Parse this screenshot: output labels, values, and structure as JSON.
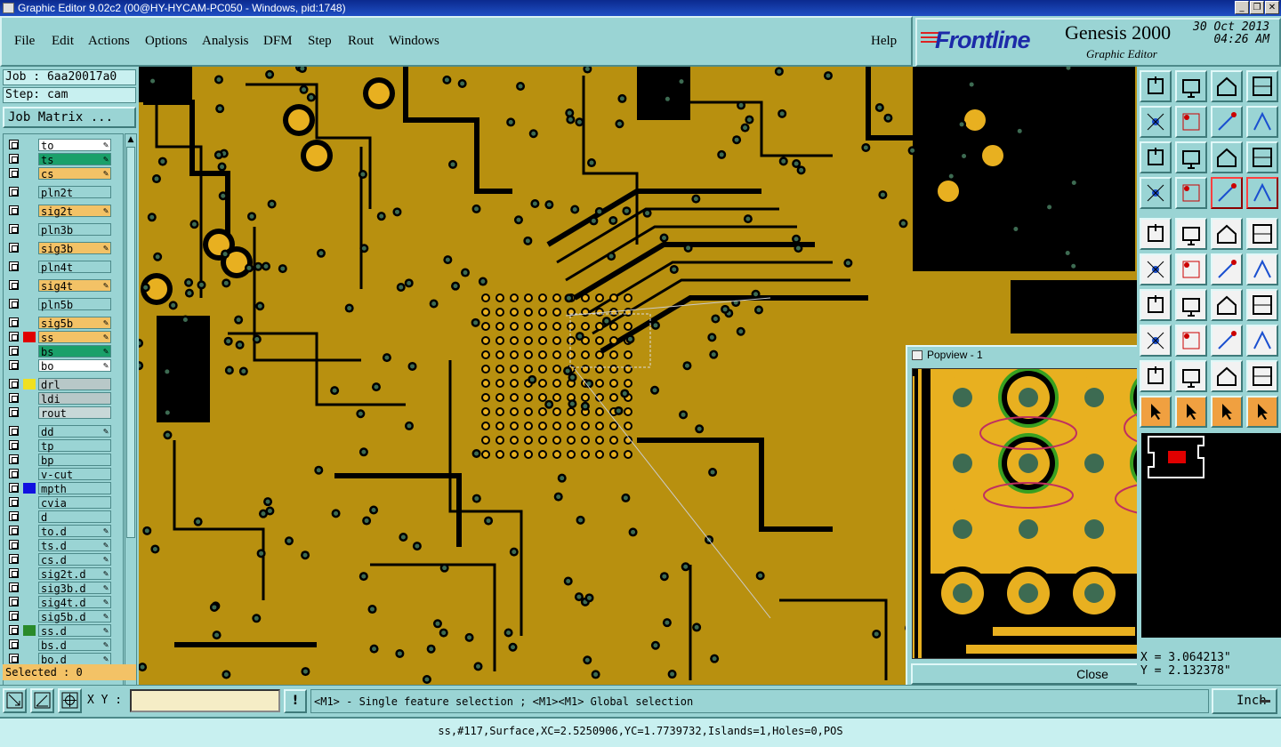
{
  "window": {
    "title": "Graphic Editor 9.02c2 (00@HY-HYCAM-PC050 - Windows, pid:1748)"
  },
  "menu": [
    "File",
    "Edit",
    "Actions",
    "Options",
    "Analysis",
    "DFM",
    "Step",
    "Rout",
    "Windows"
  ],
  "help": "Help",
  "branding": {
    "logo": "Frontline",
    "product": "Genesis 2000",
    "subtitle": "Graphic Editor",
    "date": "30 Oct 2013",
    "time": "04:26 AM"
  },
  "job": {
    "job_label": "Job : 6aa20017a0",
    "step_label": "Step: cam",
    "matrix_button": "Job Matrix ..."
  },
  "layers": [
    {
      "name": "to",
      "bg": "#ffffff",
      "color": "",
      "edit": true
    },
    {
      "name": "ts",
      "bg": "#1aa06a",
      "color": "",
      "edit": true
    },
    {
      "name": "cs",
      "bg": "#f3c266",
      "color": "",
      "edit": true
    },
    {
      "name": "pln2t",
      "bg": "#9ad4d4",
      "color": "",
      "edit": false
    },
    {
      "name": "sig2t",
      "bg": "#f3c266",
      "color": "",
      "edit": true
    },
    {
      "name": "pln3b",
      "bg": "#9ad4d4",
      "color": "",
      "edit": false
    },
    {
      "name": "sig3b",
      "bg": "#f3c266",
      "color": "",
      "edit": true
    },
    {
      "name": "pln4t",
      "bg": "#9ad4d4",
      "color": "",
      "edit": false
    },
    {
      "name": "sig4t",
      "bg": "#f3c266",
      "color": "",
      "edit": true
    },
    {
      "name": "pln5b",
      "bg": "#9ad4d4",
      "color": "",
      "edit": false
    },
    {
      "name": "sig5b",
      "bg": "#f3c266",
      "color": "",
      "edit": true
    },
    {
      "name": "ss",
      "bg": "#f3c266",
      "color": "#e00000",
      "edit": true
    },
    {
      "name": "bs",
      "bg": "#1aa06a",
      "color": "",
      "edit": true
    },
    {
      "name": "bo",
      "bg": "#ffffff",
      "color": "",
      "edit": true
    },
    {
      "name": "drl",
      "bg": "#b8c8c8",
      "color": "#f0e020",
      "edit": false
    },
    {
      "name": "ldi",
      "bg": "#b8c8c8",
      "color": "",
      "edit": false
    },
    {
      "name": "rout",
      "bg": "#c8d8d8",
      "color": "",
      "edit": false
    },
    {
      "name": "dd",
      "bg": "#9ad4d4",
      "color": "",
      "edit": true
    },
    {
      "name": "tp",
      "bg": "#9ad4d4",
      "color": "",
      "edit": false
    },
    {
      "name": "bp",
      "bg": "#9ad4d4",
      "color": "",
      "edit": false
    },
    {
      "name": "v-cut",
      "bg": "#9ad4d4",
      "color": "",
      "edit": false
    },
    {
      "name": "mpth",
      "bg": "#9ad4d4",
      "color": "#1010e0",
      "edit": false
    },
    {
      "name": "cvia",
      "bg": "#9ad4d4",
      "color": "",
      "edit": false
    },
    {
      "name": "d",
      "bg": "#9ad4d4",
      "color": "",
      "edit": false
    },
    {
      "name": "to.d",
      "bg": "#9ad4d4",
      "color": "",
      "edit": true
    },
    {
      "name": "ts.d",
      "bg": "#9ad4d4",
      "color": "",
      "edit": true
    },
    {
      "name": "cs.d",
      "bg": "#9ad4d4",
      "color": "",
      "edit": true
    },
    {
      "name": "sig2t.d",
      "bg": "#9ad4d4",
      "color": "",
      "edit": true
    },
    {
      "name": "sig3b.d",
      "bg": "#9ad4d4",
      "color": "",
      "edit": true
    },
    {
      "name": "sig4t.d",
      "bg": "#9ad4d4",
      "color": "",
      "edit": true
    },
    {
      "name": "sig5b.d",
      "bg": "#9ad4d4",
      "color": "",
      "edit": true
    },
    {
      "name": "ss.d",
      "bg": "#9ad4d4",
      "color": "#2a8a2a",
      "edit": true
    },
    {
      "name": "bs.d",
      "bg": "#9ad4d4",
      "color": "",
      "edit": true
    },
    {
      "name": "bo.d",
      "bg": "#9ad4d4",
      "color": "",
      "edit": true
    }
  ],
  "selected": "Selected : 0",
  "popview": {
    "title": "Popview - 1",
    "close_label": "Close"
  },
  "coords": {
    "x": "X = 3.064213\"",
    "y": "Y = 2.132378\""
  },
  "input": {
    "xy_label": "X Y :",
    "value": ""
  },
  "hint": "<M1> - Single feature selection ; <M1><M1> Global selection",
  "unit": "Inch",
  "status": "ss,#117,Surface,XC=2.5250906,YC=1.7739732,Islands=1,Holes=0,POS",
  "colors": {
    "board": "#b8900f",
    "copper": "#e8b020",
    "pad_ring": "#38a020",
    "drill": "#3d6b52",
    "highlight": "#c03060"
  }
}
